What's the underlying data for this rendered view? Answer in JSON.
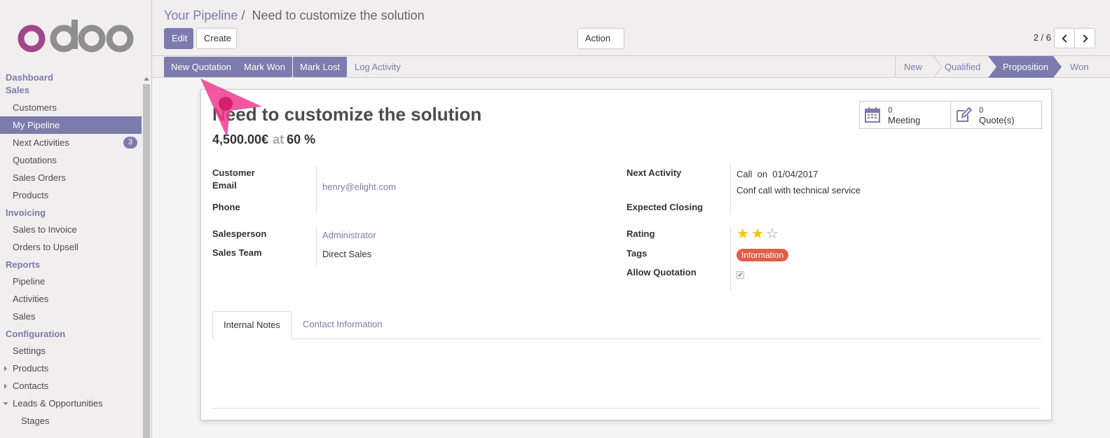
{
  "colors": {
    "brand": "#7c7bad",
    "tag": "#e45c46",
    "star": "#f7c300",
    "logo_o": "#a24689",
    "logo_doo": "#8f8f8f"
  },
  "logo": {
    "text": "odoo"
  },
  "sidebar": {
    "sections": [
      {
        "heading": "Dashboard",
        "items": []
      },
      {
        "heading": "Sales",
        "items": [
          {
            "label": "Customers"
          },
          {
            "label": "My Pipeline",
            "active": true
          },
          {
            "label": "Next Activities",
            "badge": "3"
          },
          {
            "label": "Quotations"
          },
          {
            "label": "Sales Orders"
          },
          {
            "label": "Products"
          }
        ]
      },
      {
        "heading": "Invoicing",
        "items": [
          {
            "label": "Sales to Invoice"
          },
          {
            "label": "Orders to Upsell"
          }
        ]
      },
      {
        "heading": "Reports",
        "items": [
          {
            "label": "Pipeline"
          },
          {
            "label": "Activities"
          },
          {
            "label": "Sales"
          }
        ]
      },
      {
        "heading": "Configuration",
        "items": [
          {
            "label": "Settings"
          },
          {
            "label": "Products",
            "caret": "right"
          },
          {
            "label": "Contacts",
            "caret": "right"
          },
          {
            "label": "Leads & Opportunities",
            "caret": "down"
          },
          {
            "label": "Stages",
            "indent": true
          }
        ]
      }
    ]
  },
  "breadcrumb": {
    "parent": "Your Pipeline",
    "separator": "/",
    "current": "Need to customize the solution"
  },
  "toolbar": {
    "edit": "Edit",
    "create": "Create",
    "action": "Action"
  },
  "pager": {
    "text": "2 / 6"
  },
  "statusbar": {
    "buttons": [
      "New Quotation",
      "Mark Won",
      "Mark Lost"
    ],
    "link": "Log Activity",
    "stages": [
      "New",
      "Qualified",
      "Proposition",
      "Won"
    ],
    "active_stage": "Proposition"
  },
  "record": {
    "title": "Need to customize the solution",
    "revenue": "4,500.00€",
    "at": "at",
    "probability": "60 %",
    "smart_buttons": [
      {
        "count": "0",
        "label": "Meeting",
        "icon": "calendar-icon"
      },
      {
        "count": "0",
        "label": "Quote(s)",
        "icon": "edit-icon"
      }
    ],
    "labels": {
      "customer": "Customer",
      "email": "Email",
      "phone": "Phone",
      "salesperson": "Salesperson",
      "sales_team": "Sales Team",
      "next_activity": "Next Activity",
      "expected_closing": "Expected Closing",
      "rating": "Rating",
      "tags": "Tags",
      "allow_quotation": "Allow Quotation"
    },
    "values": {
      "email": "henry@elight.com",
      "salesperson": "Administrator",
      "sales_team": "Direct Sales",
      "activity_type": "Call",
      "activity_on": "on",
      "activity_date": "01/04/2017",
      "activity_summary": "Conf call with technical service",
      "rating": 2,
      "rating_max": 3,
      "tag": "Information",
      "allow_quotation": true
    },
    "tabs": [
      "Internal Notes",
      "Contact Information"
    ],
    "active_tab": "Internal Notes"
  }
}
